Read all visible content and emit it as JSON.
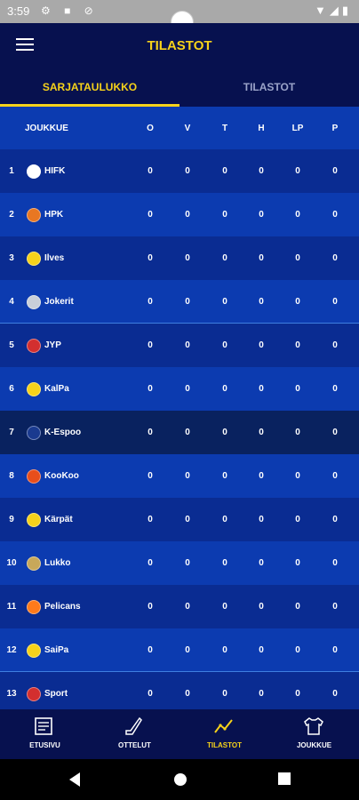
{
  "status": {
    "time": "3:59"
  },
  "appbar": {
    "title": "TILASTOT"
  },
  "tabs": [
    {
      "label": "SARJATAULUKKO",
      "active": true
    },
    {
      "label": "TILASTOT",
      "active": false
    }
  ],
  "table": {
    "headers": {
      "team": "JOUKKUE",
      "cols": [
        "O",
        "V",
        "T",
        "H",
        "LP",
        "P"
      ]
    },
    "rows": [
      {
        "rank": "1",
        "team": "HIFK",
        "vals": [
          "0",
          "0",
          "0",
          "0",
          "0",
          "0"
        ]
      },
      {
        "rank": "2",
        "team": "HPK",
        "vals": [
          "0",
          "0",
          "0",
          "0",
          "0",
          "0"
        ]
      },
      {
        "rank": "3",
        "team": "Ilves",
        "vals": [
          "0",
          "0",
          "0",
          "0",
          "0",
          "0"
        ]
      },
      {
        "rank": "4",
        "team": "Jokerit",
        "vals": [
          "0",
          "0",
          "0",
          "0",
          "0",
          "0"
        ]
      },
      {
        "rank": "5",
        "team": "JYP",
        "vals": [
          "0",
          "0",
          "0",
          "0",
          "0",
          "0"
        ]
      },
      {
        "rank": "6",
        "team": "KalPa",
        "vals": [
          "0",
          "0",
          "0",
          "0",
          "0",
          "0"
        ]
      },
      {
        "rank": "7",
        "team": "K-Espoo",
        "vals": [
          "0",
          "0",
          "0",
          "0",
          "0",
          "0"
        ]
      },
      {
        "rank": "8",
        "team": "KooKoo",
        "vals": [
          "0",
          "0",
          "0",
          "0",
          "0",
          "0"
        ]
      },
      {
        "rank": "9",
        "team": "Kärpät",
        "vals": [
          "0",
          "0",
          "0",
          "0",
          "0",
          "0"
        ]
      },
      {
        "rank": "10",
        "team": "Lukko",
        "vals": [
          "0",
          "0",
          "0",
          "0",
          "0",
          "0"
        ]
      },
      {
        "rank": "11",
        "team": "Pelicans",
        "vals": [
          "0",
          "0",
          "0",
          "0",
          "0",
          "0"
        ]
      },
      {
        "rank": "12",
        "team": "SaiPa",
        "vals": [
          "0",
          "0",
          "0",
          "0",
          "0",
          "0"
        ]
      },
      {
        "rank": "13",
        "team": "Sport",
        "vals": [
          "0",
          "0",
          "0",
          "0",
          "0",
          "0"
        ]
      }
    ]
  },
  "bottomnav": [
    {
      "label": "ETUSIVU",
      "icon": "news-icon",
      "active": false
    },
    {
      "label": "OTTELUT",
      "icon": "hockey-stick-icon",
      "active": false
    },
    {
      "label": "TILASTOT",
      "icon": "stats-line-icon",
      "active": true
    },
    {
      "label": "JOUKKUE",
      "icon": "jersey-icon",
      "active": false
    }
  ],
  "colors": {
    "accent": "#f6d21a",
    "row_light": "#0c3bb0",
    "row_dark": "#0a2c92",
    "row_highlight": "#09225f",
    "bar": "#07114f"
  }
}
